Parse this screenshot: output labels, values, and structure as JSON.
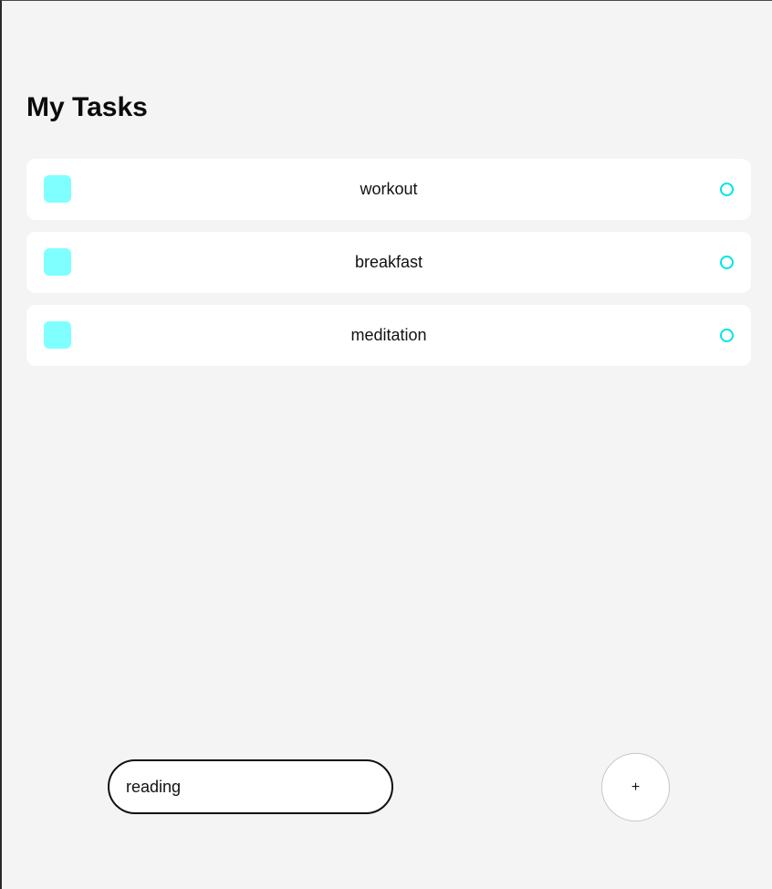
{
  "header": {
    "title": "My Tasks"
  },
  "tasks": [
    {
      "label": "workout"
    },
    {
      "label": "breakfast"
    },
    {
      "label": "meditation"
    }
  ],
  "composer": {
    "input_value": "reading",
    "add_label": "+"
  },
  "colors": {
    "background": "#f4f4f4",
    "card": "#ffffff",
    "task_square": "#7fffff",
    "task_circle": "#00e5e5"
  }
}
